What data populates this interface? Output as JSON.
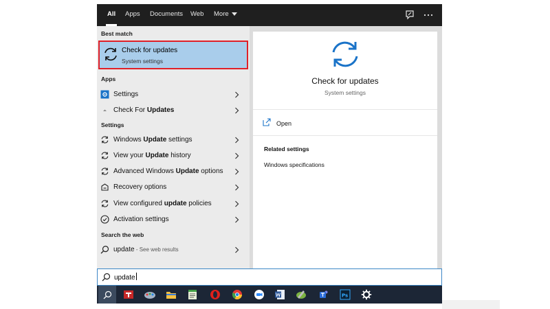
{
  "tabs": [
    {
      "label": "All",
      "active": true
    },
    {
      "label": "Apps"
    },
    {
      "label": "Documents"
    },
    {
      "label": "Web"
    },
    {
      "label": "More"
    }
  ],
  "top_icons": [
    "feedback-icon",
    "more-options-icon"
  ],
  "left": {
    "best_match_heading": "Best match",
    "best_match": {
      "title": "Check for updates",
      "subtitle": "System settings",
      "icon": "sync-icon"
    },
    "apps_heading": "Apps",
    "apps": [
      {
        "label": "Settings",
        "icon": "settings-app-icon"
      },
      {
        "label_pre": "Check For ",
        "label_bold": "Updates",
        "icon": "app-icon"
      }
    ],
    "settings_heading": "Settings",
    "settings": [
      {
        "pre": "Windows ",
        "bold": "Update",
        "post": " settings",
        "icon": "sync-icon"
      },
      {
        "pre": "View your ",
        "bold": "Update",
        "post": " history",
        "icon": "sync-icon"
      },
      {
        "pre": "Advanced Windows ",
        "bold": "Update",
        "post": " options",
        "icon": "sync-icon"
      },
      {
        "pre": "Recovery options",
        "bold": "",
        "post": "",
        "icon": "recovery-icon"
      },
      {
        "pre": "View configured ",
        "bold": "update",
        "post": " policies",
        "icon": "sync-icon"
      },
      {
        "pre": "Activation settings",
        "bold": "",
        "post": "",
        "icon": "check-circle-icon"
      }
    ],
    "web_heading": "Search the web",
    "web": {
      "query": "update",
      "suffix": " - See web results",
      "icon": "search-icon"
    }
  },
  "right": {
    "title": "Check for updates",
    "subtitle": "System settings",
    "open_label": "Open",
    "related_heading": "Related settings",
    "related_links": [
      "Windows specifications"
    ]
  },
  "search": {
    "value": "update",
    "icon": "search-icon"
  },
  "taskbar_icons": [
    "search-icon",
    "app-red-icon",
    "paint-icon",
    "file-explorer-icon",
    "notepad-icon",
    "opera-icon",
    "chrome-icon",
    "zoom-icon",
    "word-icon",
    "app-icon",
    "teams-icon",
    "photoshop-icon",
    "settings-icon"
  ],
  "colors": {
    "accent": "#3b86c6",
    "highlight": "#a9cdeb",
    "highlight_border": "#e01f27",
    "topbar": "#1f1f1f",
    "taskbar": "#1c2636"
  }
}
